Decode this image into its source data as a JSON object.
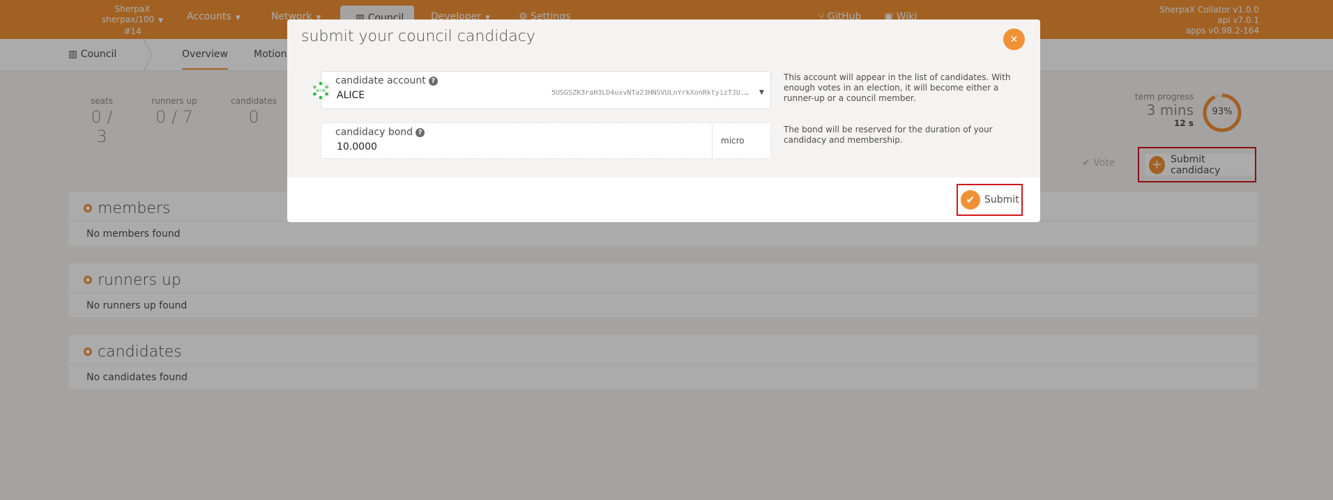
{
  "topbar": {
    "chain_name": "SherpaX",
    "chain_spec": "sherpax/100",
    "block": "#14",
    "nav": {
      "accounts": "Accounts",
      "network": "Network",
      "council": "Council",
      "developer": "Developer",
      "settings": "Settings",
      "github": "GitHub",
      "wiki": "Wiki"
    },
    "node_info": [
      "SherpaX Collator v1.0.0",
      "api v7.0.1",
      "apps v0.98.2-164"
    ]
  },
  "subnav": {
    "section": "Council",
    "tabs": [
      "Overview",
      "Motions"
    ]
  },
  "summary": {
    "seats": {
      "label": "seats",
      "value": "0 / 3"
    },
    "runners_up": {
      "label": "runners up",
      "value": "0 / 7"
    },
    "candidates": {
      "label": "candidates",
      "value": "0"
    },
    "term": {
      "label": "term progress",
      "value": "3 mins",
      "sub": "12 s",
      "percent_label": "93%",
      "percent": 93
    }
  },
  "actions": {
    "vote": "Vote",
    "submit_candidacy": "Submit candidacy"
  },
  "sections": [
    {
      "title": "members",
      "empty": "No members found"
    },
    {
      "title": "runners up",
      "empty": "No runners up found"
    },
    {
      "title": "candidates",
      "empty": "No candidates found"
    }
  ],
  "modal": {
    "title": "submit your council candidacy",
    "close_icon": "close-icon",
    "account": {
      "label": "candidate account",
      "name": "ALICE",
      "address": "5USGSZK3raH3LD4uxvNTa23HNSVULnYrkXonRktyizTJU..."
    },
    "account_help": "This account will appear in the list of candidates. With enough votes in an election, it will become either a runner-up or a council member.",
    "bond": {
      "label": "candidacy bond",
      "value": "10.0000",
      "unit": "micro"
    },
    "bond_help": "The bond will be reserved for the duration of your candidacy and membership.",
    "submit": "Submit"
  },
  "colors": {
    "accent": "#f19135",
    "highlight": "#d2141c"
  }
}
